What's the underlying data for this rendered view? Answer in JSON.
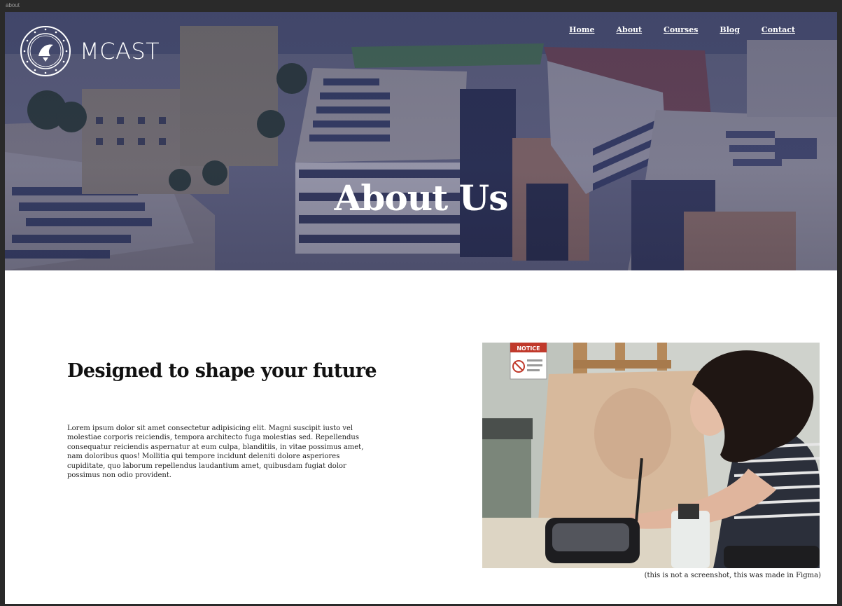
{
  "window": {
    "frame_label": "about"
  },
  "brand": {
    "name": "MCAST",
    "seal_text": "MALTA COLLEGE OF ARTS SCIENCE AND TECHNOLOGY"
  },
  "nav": {
    "items": [
      {
        "label": "Home"
      },
      {
        "label": "About"
      },
      {
        "label": "Courses"
      },
      {
        "label": "Blog"
      },
      {
        "label": "Contact"
      }
    ]
  },
  "hero": {
    "title": "About Us"
  },
  "section": {
    "heading": "Designed to shape your future",
    "body": "Lorem ipsum dolor sit amet consectetur adipisicing elit. Magni suscipit iusto vel molestiae corporis reiciendis, tempora architecto fuga molestias sed. Repellendus consequatur reiciendis aspernatur at eum culpa, blanditiis, in vitae possimus amet, nam doloribus quos! Mollitia qui tempore incidunt deleniti dolore asperiores cupiditate, quo laborum repellendus laudantium amet, quibusdam fugiat dolor possimus non odio provident."
  },
  "photo": {
    "sign_text": "NOTICE",
    "caption": "(this is not a screenshot, this was made in Figma)"
  },
  "colors": {
    "hero_tint": "#2b3268",
    "text": "#111111",
    "frame": "#2a2a2a"
  }
}
